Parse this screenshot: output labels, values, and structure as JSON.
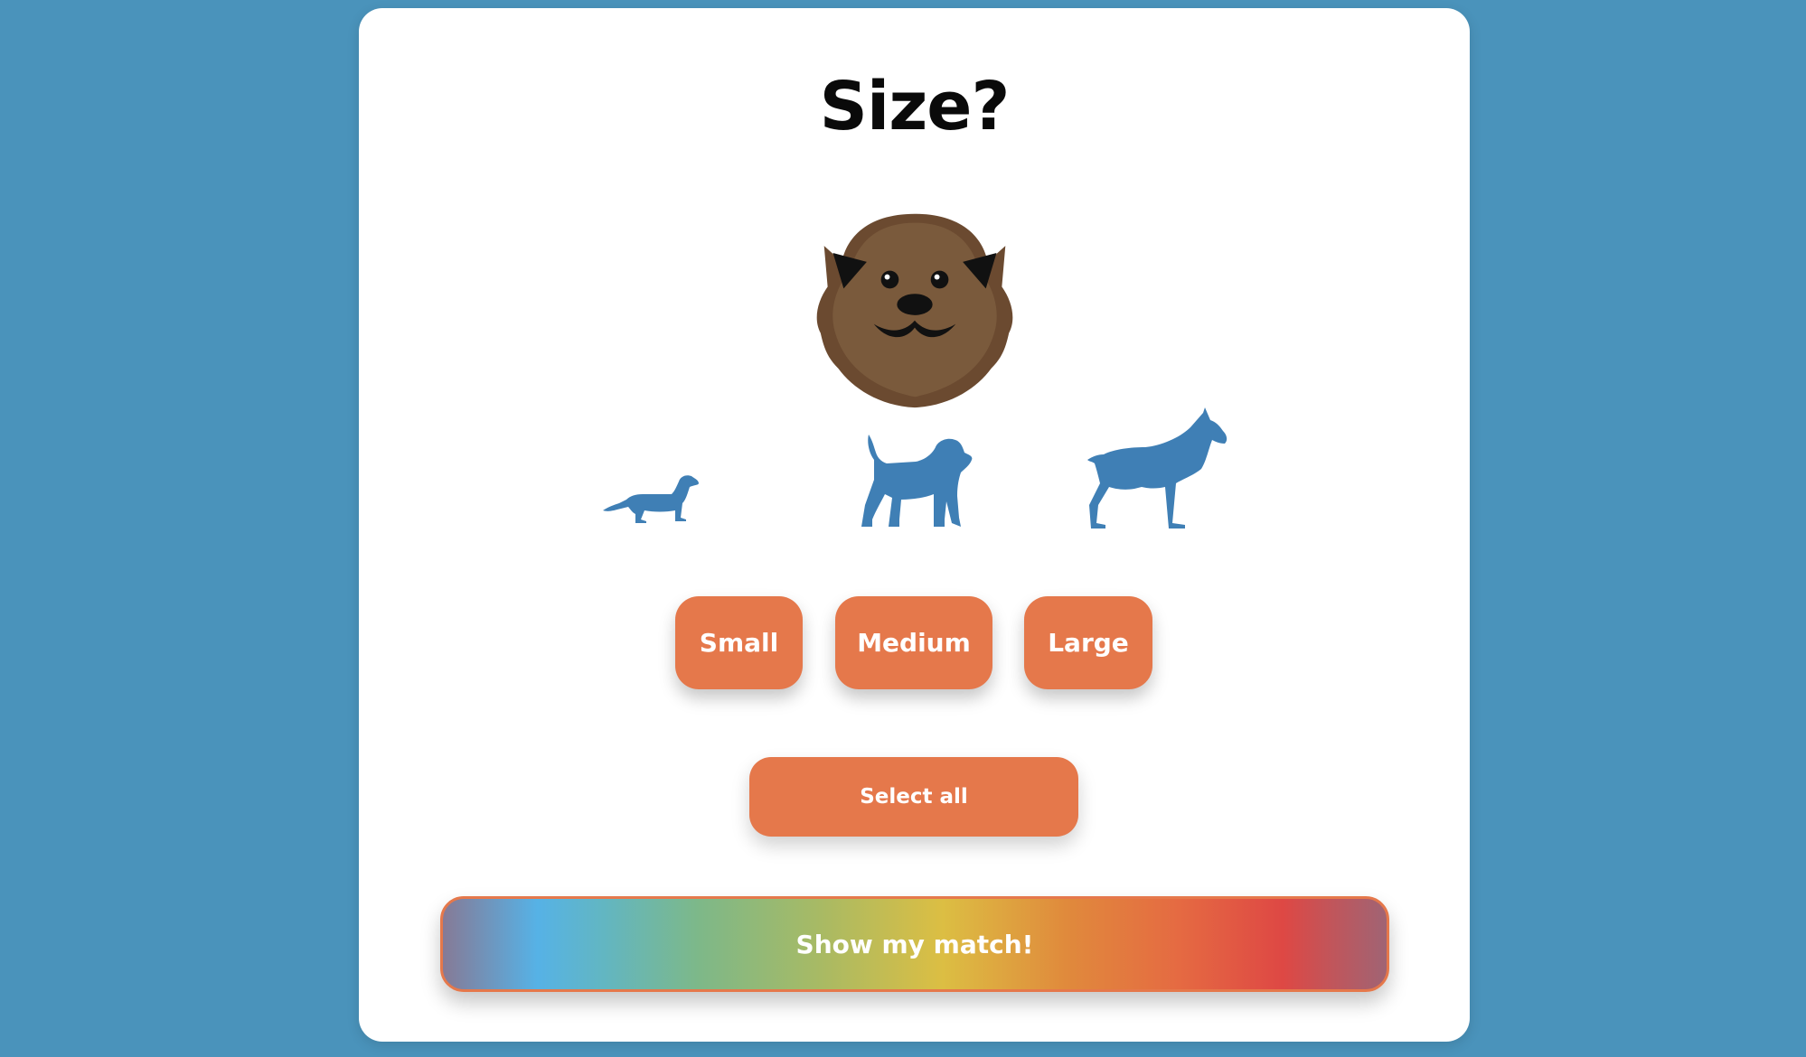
{
  "page": {
    "title": "Size?"
  },
  "mascot": {
    "icon": "dog-face-icon"
  },
  "sizes": {
    "small": {
      "label": "Small",
      "icon": "small-dog-silhouette-icon"
    },
    "medium": {
      "label": "Medium",
      "icon": "medium-dog-silhouette-icon"
    },
    "large": {
      "label": "Large",
      "icon": "large-dog-silhouette-icon"
    }
  },
  "actions": {
    "select_all_label": "Select all",
    "show_match_label": "Show my match!"
  },
  "colors": {
    "background": "#4a93bb",
    "accent": "#e5784b",
    "silhouette": "#3f7fb5",
    "mascot_fur": "#7a5a3c"
  }
}
